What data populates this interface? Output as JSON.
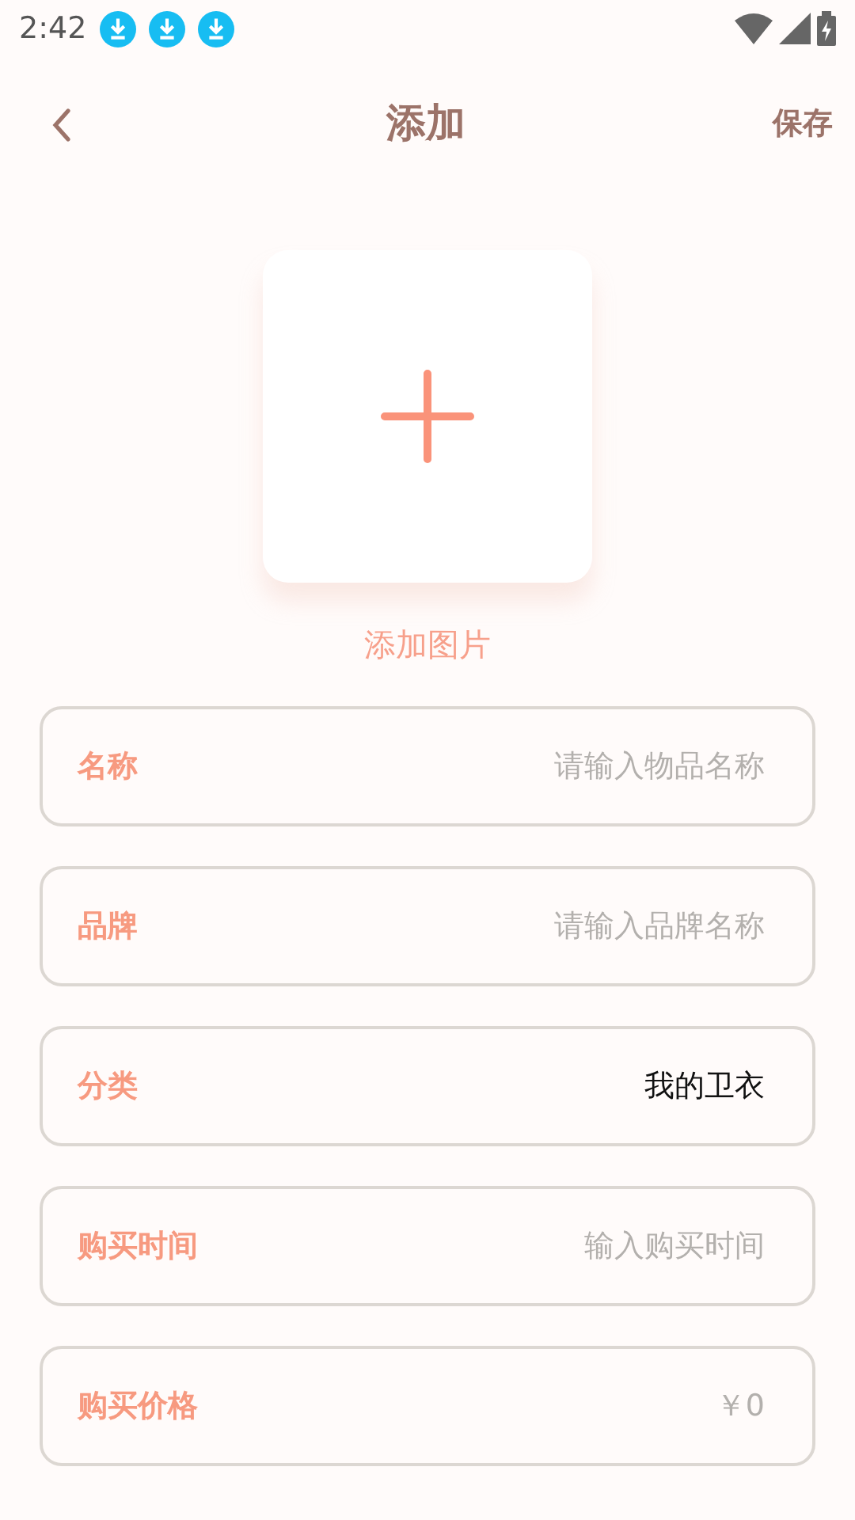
{
  "status_bar": {
    "time": "2:42"
  },
  "header": {
    "title": "添加",
    "action": "保存"
  },
  "image_picker": {
    "caption": "添加图片"
  },
  "fields": [
    {
      "label": "名称",
      "placeholder": "请输入物品名称"
    },
    {
      "label": "品牌",
      "placeholder": "请输入品牌名称"
    },
    {
      "label": "分类",
      "value": "我的卫衣"
    },
    {
      "label": "购买时间",
      "placeholder": "输入购买时间"
    },
    {
      "label": "购买价格",
      "placeholder": "￥0"
    }
  ]
}
